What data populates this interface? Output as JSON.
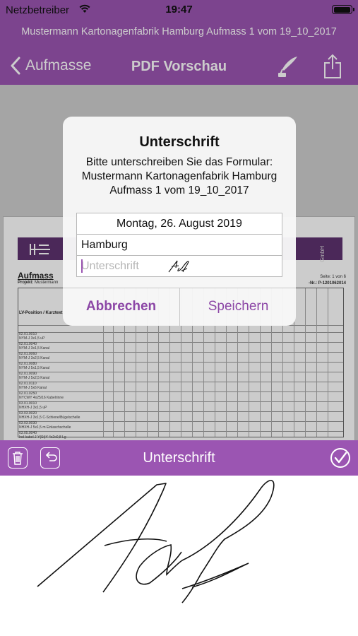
{
  "status_bar": {
    "carrier": "Netzbetreiber",
    "time": "19:47"
  },
  "document_title": "Mustermann Kartonagenfabrik Hamburg Aufmass 1 vom 19_10_2017",
  "nav": {
    "back_label": "Aufmasse",
    "title": "PDF Vorschau"
  },
  "pdf_preview": {
    "heading": "Aufmass",
    "project_label": "Projekt:",
    "project_value": "Mustermann",
    "page_info": "Seite: 1 von 6",
    "order_no": "-Nr.: P-1201062014",
    "company_suffix": "GmbH",
    "lv_header": "LV-Position / Kurztext",
    "rows": [
      "02.01.0010",
      "NYM-J 3x1,5 uP",
      "02.01.0040",
      "NYM-J 3x1,5 Kanal",
      "02.01.0060",
      "NYM-J 3x2,5 Kanal",
      "02.01.0080",
      "NYM-J 5x1,5 Kanal",
      "02.01.0090",
      "NYM-J 5x2,5 Kanal",
      "02.01.0110",
      "NYM-J 5x6 Kanal",
      "02.01.0250",
      "NYCWY 4x25/16 Kabelrinne",
      "03.01.0010",
      "NHXH-J 3x1,5 uP",
      "03.03.0020",
      "NHXH-J 3x1,5 C-Schiene/Bügelschelle",
      "03.03.0030",
      "NHXH-J 5x1,5 m Einlaschschelle",
      "03.05.0040",
      "Ind-kabel J-Y(St)Y 4x2x0,8 Lg",
      "03.05.0050",
      "Ind-kabel J-Y(St)Y 4x2x0,8 Lg"
    ]
  },
  "alert": {
    "title": "Unterschrift",
    "message": "Bitte unterschreiben Sie das Formular: Mustermann Kartonagenfabrik Hamburg Aufmass 1 vom 19_10_2017",
    "date_value": "Montag, 26. August 2019",
    "city_value": "Hamburg",
    "signature_placeholder": "Unterschrift",
    "cancel_label": "Abbrechen",
    "save_label": "Speichern"
  },
  "toolbar": {
    "title": "Unterschrift"
  },
  "icons": {
    "back": "chevron-left-icon",
    "pen": "quill-pen-icon",
    "share": "share-icon",
    "trash": "trash-icon",
    "undo": "undo-icon",
    "confirm": "checkmark-circle-icon"
  },
  "colors": {
    "accent": "#9B55B2",
    "button_text": "#8C47A6",
    "background": "#FFFFFF"
  }
}
